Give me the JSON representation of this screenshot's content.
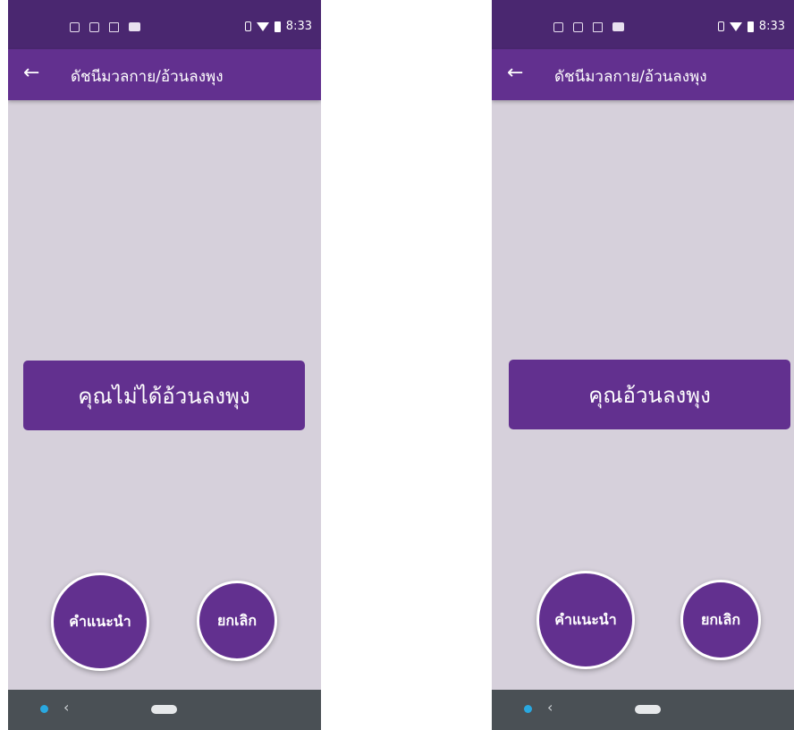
{
  "screens": [
    {
      "status": {
        "time": "8:33"
      },
      "appbar": {
        "back_icon": "←",
        "title": "ดัชนีมวลกาย/อ้วนลงพุง"
      },
      "result": "คุณไม่ได้อ้วนลงพุง",
      "buttons": {
        "advice": "คำแนะนำ",
        "cancel": "ยกเลิก"
      },
      "nav": {
        "back_glyph": "‹"
      }
    },
    {
      "status": {
        "time": "8:33"
      },
      "appbar": {
        "back_icon": "←",
        "title": "ดัชนีมวลกาย/อ้วนลงพุง"
      },
      "result": "คุณอ้วนลงพุง",
      "buttons": {
        "advice": "คำแนะนำ",
        "cancel": "ยกเลิก"
      },
      "nav": {
        "back_glyph": "‹"
      }
    }
  ],
  "colors": {
    "primary": "#62308f",
    "status_bar": "#4a2770",
    "background": "#d6d0db",
    "nav_bar": "#4a5055"
  }
}
